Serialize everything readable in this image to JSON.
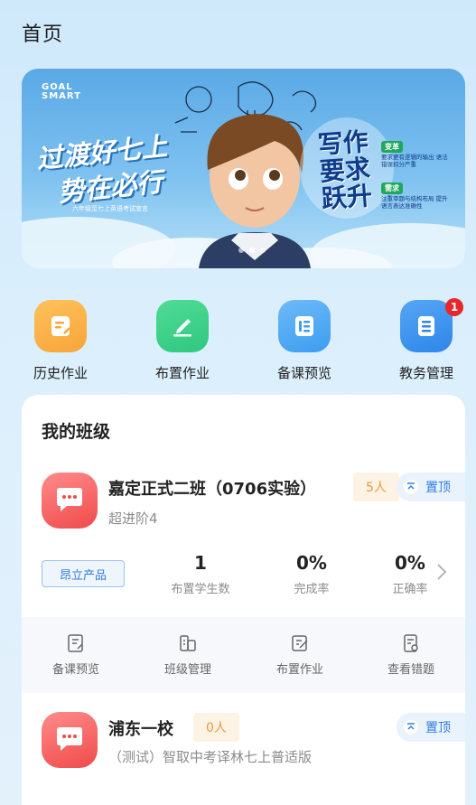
{
  "page": {
    "title": "首页"
  },
  "banner": {
    "logo": "GOAL\nSMART",
    "slogan_line1": "过渡好七上",
    "slogan_line2": "势在必行",
    "subtitle": "六年级至七上英语考试宣言",
    "right_title": "写作要求跃升",
    "tag1": "变革",
    "tag1_text": "要求更有逻辑的输出 语法错误扣分严重",
    "tag2": "需求",
    "tag2_text": "注重审题与结构布局 提升语言表达准确性",
    "slide_count": 3,
    "active_slide": 1
  },
  "quick_actions": [
    {
      "label": "历史作业",
      "icon": "history-homework-icon",
      "color": "#f7a53a"
    },
    {
      "label": "布置作业",
      "icon": "assign-homework-icon",
      "color": "#2fc780"
    },
    {
      "label": "备课预览",
      "icon": "lesson-preview-icon",
      "color": "#3d9df0"
    },
    {
      "label": "教务管理",
      "icon": "academic-admin-icon",
      "color": "#2e86e8",
      "badge": "1"
    }
  ],
  "my_classes": {
    "title": "我的班级",
    "classes": [
      {
        "name": "嘉定正式二班（0706实验）",
        "count": "5人",
        "level": "超进阶4",
        "pin_label": "置顶",
        "product": "昂立产品",
        "stats": [
          {
            "value": "1",
            "label": "布置学生数"
          },
          {
            "value": "0%",
            "label": "完成率"
          },
          {
            "value": "0%",
            "label": "正确率"
          }
        ],
        "tools": [
          "备课预览",
          "班级管理",
          "布置作业",
          "查看错题"
        ]
      },
      {
        "name": "浦东一校",
        "count": "0人",
        "level": "（测试）智取中考译林七上普适版",
        "pin_label": "置顶"
      }
    ]
  },
  "colors": {
    "accent": "#2e7ee0",
    "class_icon": "#f04a4a",
    "count_text": "#e89b3a"
  }
}
